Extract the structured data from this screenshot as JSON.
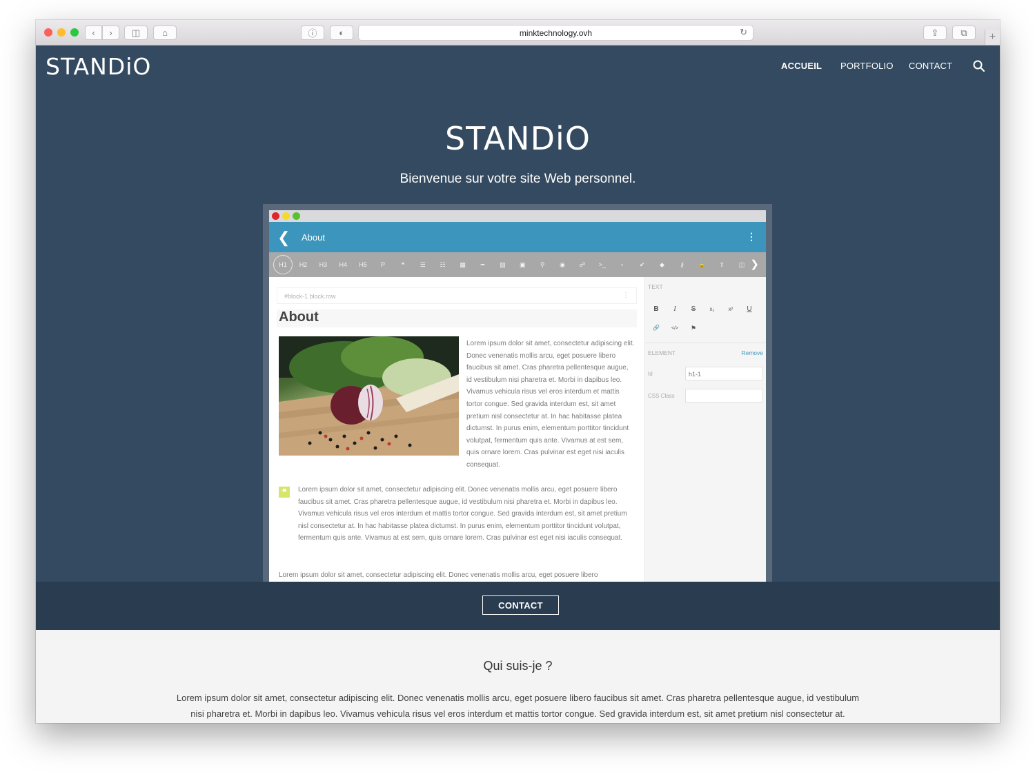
{
  "browser": {
    "url": "minktechnology.ovh",
    "traffic_lights": [
      "#fe5f57",
      "#febc2e",
      "#28c840"
    ]
  },
  "site": {
    "logo": "STANDiO",
    "nav": [
      "ACCUEIL",
      "PORTFOLIO",
      "CONTACT"
    ],
    "search_icon": "search-icon"
  },
  "hero": {
    "title": "STANDiO",
    "subtitle": "Bienvenue sur votre site Web personnel."
  },
  "editor": {
    "app_title": "About",
    "toolbar": [
      "H1",
      "H2",
      "H3",
      "H4",
      "H5",
      "P",
      "❝",
      "☰",
      "☷",
      "▦",
      "━",
      "▨",
      "▣",
      "⚲",
      "◉",
      "☍",
      ">_",
      "▫",
      "✔",
      "◆",
      "⚷",
      "🔒",
      "⇪",
      "◫"
    ],
    "block_tag": "#block-1  block.row",
    "heading": "About",
    "paragraph": "Lorem ipsum dolor sit amet, consectetur adipiscing elit. Donec venenatis mollis arcu, eget posuere libero faucibus sit amet. Cras pharetra pellentesque augue, id vestibulum nisi pharetra et. Morbi in dapibus leo. Vivamus vehicula risus vel eros interdum et mattis tortor congue. Sed gravida interdum est, sit amet pretium nisl consectetur at. In hac habitasse platea dictumst. In purus enim, elementum porttitor tincidunt volutpat, fermentum quis ante. Vivamus at est sem, quis ornare lorem. Cras pulvinar est eget nisi iaculis consequat.",
    "quote": "Lorem ipsum dolor sit amet, consectetur adipiscing elit. Donec venenatis mollis arcu, eget posuere libero faucibus sit amet. Cras pharetra pellentesque augue, id vestibulum nisi pharetra et. Morbi in dapibus leo. Vivamus vehicula risus vel eros interdum et mattis tortor congue. Sed gravida interdum est, sit amet pretium nisl consectetur at. In hac habitasse platea dictumst. In purus enim, elementum porttitor tincidunt volutpat, fermentum quis ante. Vivamus at est sem, quis ornare lorem. Cras pulvinar est eget nisi iaculis consequat.",
    "last_line": "Lorem ipsum dolor sit amet, consectetur adipiscing elit. Donec venenatis mollis arcu, eget posuere libero",
    "side": {
      "text_label": "TEXT",
      "formats": [
        "B",
        "I",
        "S",
        "x₂",
        "x²",
        "U",
        "🔗",
        "</>",
        "⚑"
      ],
      "element_label": "ELEMENT",
      "remove": "Remove",
      "id_label": "Id",
      "id_value": "h1-1",
      "css_label": "CSS Class",
      "css_value": ""
    },
    "accent": "#3c95bc"
  },
  "cta": {
    "label": "CONTACT"
  },
  "about": {
    "title": "Qui suis-je ?",
    "text": "Lorem ipsum dolor sit amet, consectetur adipiscing elit. Donec venenatis mollis arcu, eget posuere libero faucibus sit amet. Cras pharetra pellentesque augue, id vestibulum nisi pharetra et. Morbi in dapibus leo. Vivamus vehicula risus vel eros interdum et mattis tortor congue. Sed gravida interdum est, sit amet pretium nisl consectetur at."
  }
}
